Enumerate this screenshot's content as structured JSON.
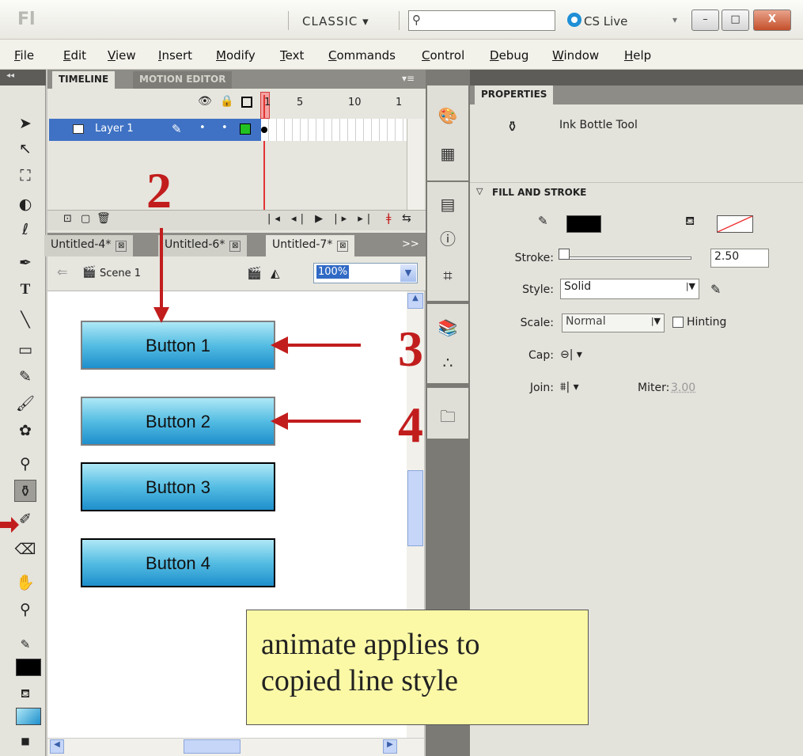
{
  "titlebar": {
    "logo": "Fl",
    "workspace": "CLASSIC ▾",
    "search_icon": "⚲",
    "cslive": "CS Live",
    "cslive_arrow": "▾",
    "minimize": "–",
    "maximize": "□",
    "close": "X"
  },
  "menubar": [
    "File",
    "Edit",
    "View",
    "Insert",
    "Modify",
    "Text",
    "Commands",
    "Control",
    "Debug",
    "Window",
    "Help"
  ],
  "toolbar": {
    "collapse": "◂◂",
    "tools": [
      "selection-arrow",
      "subselection",
      "free-transform",
      "3d-rotation",
      "lasso",
      "pen",
      "text",
      "line",
      "rectangle",
      "pencil",
      "brush",
      "deco",
      "bone",
      "ink-bottle",
      "eyedropper",
      "eraser",
      "hand",
      "zoom"
    ]
  },
  "timeline": {
    "tab_timeline": "TIMELINE",
    "tab_motion": "MOTION EDITOR",
    "layer_name": "Layer 1",
    "frame_labels": [
      "1",
      "5",
      "10",
      "1"
    ]
  },
  "documents": {
    "tabs": [
      "Untitled-4*",
      "Untitled-6*",
      "Untitled-7*"
    ],
    "close_glyph": "⊠",
    "overflow": ">>",
    "scene": "Scene 1",
    "zoom": "100%"
  },
  "stage": {
    "buttons": [
      "Button 1",
      "Button 2",
      "Button 3",
      "Button 4"
    ]
  },
  "properties": {
    "tab": "PROPERTIES",
    "tool": "Ink Bottle Tool",
    "section": "FILL AND STROKE",
    "stroke_label": "Stroke:",
    "stroke_value": "2.50",
    "style_label": "Style:",
    "style_value": "Solid",
    "scale_label": "Scale:",
    "scale_value": "Normal",
    "hinting": "Hinting",
    "cap_label": "Cap:",
    "join_label": "Join:",
    "miter_label": "Miter:",
    "miter_value": "3.00"
  },
  "annotations": {
    "step_2": "2",
    "step_3": "3",
    "step_4": "4",
    "note_line1": "animate applies to",
    "note_line2": "copied line style"
  },
  "colors": {
    "arrow": "#c21d1d",
    "layer_highlight": "#3f72c4",
    "note_bg": "#fbf9a6"
  }
}
